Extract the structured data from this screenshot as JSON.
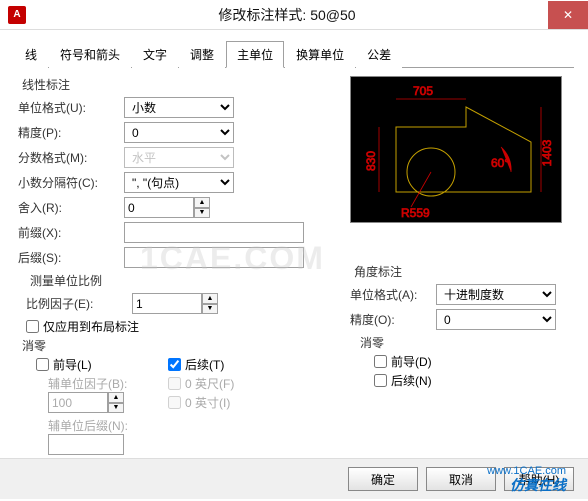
{
  "window": {
    "app_icon_text": "A",
    "title": "修改标注样式: 50@50",
    "close_text": "✕"
  },
  "tabs": {
    "items": [
      {
        "label": "线"
      },
      {
        "label": "符号和箭头"
      },
      {
        "label": "文字"
      },
      {
        "label": "调整"
      },
      {
        "label": "主单位"
      },
      {
        "label": "换算单位"
      },
      {
        "label": "公差"
      }
    ],
    "active_index": 4
  },
  "linear": {
    "legend": "线性标注",
    "unit_format_label": "单位格式(U):",
    "unit_format_value": "小数",
    "precision_label": "精度(P):",
    "precision_value": "0",
    "fraction_format_label": "分数格式(M):",
    "fraction_format_value": "水平",
    "decimal_sep_label": "小数分隔符(C):",
    "decimal_sep_value": "\", \"(句点)",
    "roundoff_label": "舍入(R):",
    "roundoff_value": "0",
    "prefix_label": "前缀(X):",
    "prefix_value": "",
    "suffix_label": "后缀(S):",
    "suffix_value": ""
  },
  "scale": {
    "legend": "测量单位比例",
    "factor_label": "比例因子(E):",
    "factor_value": "1",
    "layout_only_label": "仅应用到布局标注"
  },
  "suppress": {
    "legend": "消零",
    "leading_label": "前导(L)",
    "trailing_label": "后续(T)",
    "trailing_checked": true,
    "aux_factor_label": "辅单位因子(B):",
    "aux_factor_value": "100",
    "aux_suffix_label": "辅单位后缀(N):",
    "aux_suffix_value": "",
    "feet_label": "0 英尺(F)",
    "inches_label": "0 英寸(I)"
  },
  "angular": {
    "legend": "角度标注",
    "unit_format_label": "单位格式(A):",
    "unit_format_value": "十进制度数",
    "precision_label": "精度(O):",
    "precision_value": "0",
    "suppress_legend": "消零",
    "leading_label": "前导(D)",
    "trailing_label": "后续(N)"
  },
  "preview": {
    "d1": "705",
    "d2": "830",
    "d3": "R559",
    "d4": "60°",
    "d5": "1403"
  },
  "buttons": {
    "ok": "确定",
    "cancel": "取消",
    "help": "帮助(H)"
  },
  "watermarks": {
    "w1": "1CAE.COM",
    "w2": "仿真在线",
    "w3": "www.1CAE.com"
  }
}
